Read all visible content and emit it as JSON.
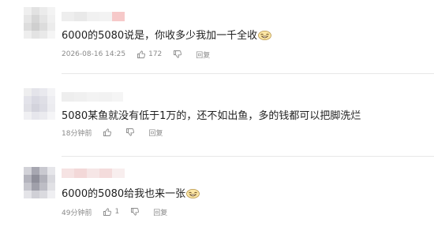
{
  "comments": [
    {
      "text": "6000的5080说是，你收多少我加一千全收",
      "emoji": "grinning-face-emoji",
      "time": "2026-08-16 14:25",
      "likes": "172",
      "reply_label": "回复"
    },
    {
      "text": "5080某鱼就没有低于1万的，还不如出鱼，多的钱都可以把脚洗烂",
      "time": "18分钟前",
      "reply_label": "回复"
    },
    {
      "text": "6000的5080给我也来一张",
      "emoji": "grinning-face-emoji",
      "time": "49分钟前",
      "likes": "1",
      "reply_label": "回复"
    }
  ],
  "colors": {
    "meta_gray": "#8a8a8a",
    "divider": "#e8e8e8",
    "accent_pink": "#f4c0c0"
  }
}
